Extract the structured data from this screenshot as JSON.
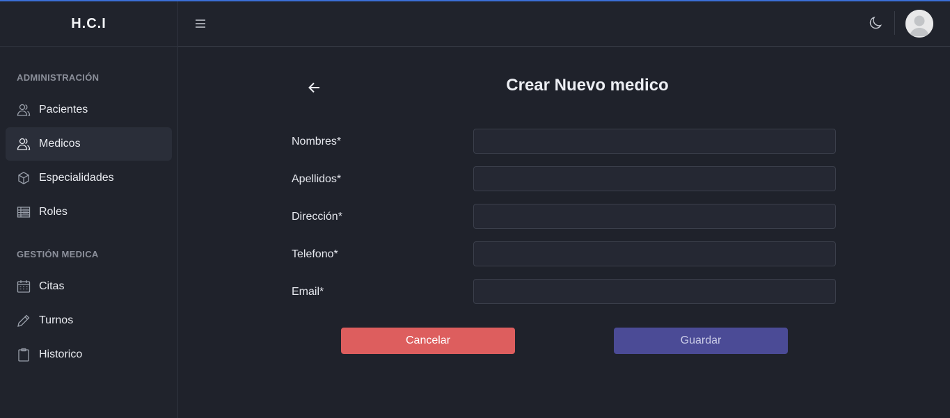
{
  "app": {
    "brand": "H.C.I"
  },
  "sidebar": {
    "sections": [
      {
        "title": "ADMINISTRACIÓN"
      },
      {
        "title": "GESTIÓN MEDICA"
      }
    ],
    "items": [
      {
        "label": "Pacientes",
        "icon": "users-icon",
        "active": false
      },
      {
        "label": "Medicos",
        "icon": "users-icon",
        "active": true
      },
      {
        "label": "Especialidades",
        "icon": "hexagon-icon",
        "active": false
      },
      {
        "label": "Roles",
        "icon": "list-table-icon",
        "active": false
      },
      {
        "label": "Citas",
        "icon": "calendar-icon",
        "active": false
      },
      {
        "label": "Turnos",
        "icon": "pencil-icon",
        "active": false
      },
      {
        "label": "Historico",
        "icon": "clipboard-icon",
        "active": false
      }
    ]
  },
  "page": {
    "title": "Crear Nuevo medico"
  },
  "form": {
    "fields": [
      {
        "label": "Nombres*",
        "value": ""
      },
      {
        "label": "Apellidos*",
        "value": ""
      },
      {
        "label": "Dirección*",
        "value": ""
      },
      {
        "label": "Telefono*",
        "value": ""
      },
      {
        "label": "Email*",
        "value": ""
      }
    ],
    "cancel_label": "Cancelar",
    "save_label": "Guardar"
  },
  "colors": {
    "background": "#1f222b",
    "accent_top": "#3b6fd6",
    "cancel": "#dd5e5e",
    "save": "#4b4b96"
  }
}
